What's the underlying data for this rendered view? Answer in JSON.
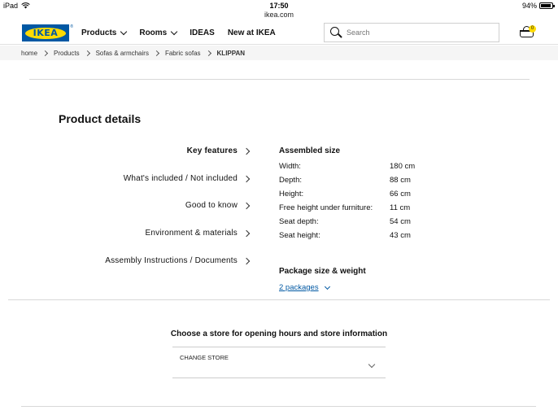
{
  "status_bar": {
    "device": "iPad",
    "time": "17:50",
    "battery": "94%",
    "battery_level": 0.94
  },
  "url": "ikea.com",
  "header": {
    "logo_text": "IKEA",
    "nav": [
      {
        "label": "Products",
        "dropdown": true
      },
      {
        "label": "Rooms",
        "dropdown": true
      },
      {
        "label": "IDEAS",
        "dropdown": false
      },
      {
        "label": "New at IKEA",
        "dropdown": false
      }
    ],
    "search_placeholder": "Search",
    "cart_count": "0"
  },
  "breadcrumb": [
    "home",
    "Products",
    "Sofas & armchairs",
    "Fabric sofas",
    "KLIPPAN"
  ],
  "product_details": {
    "title": "Product details",
    "features": [
      {
        "label": "Key features",
        "active": true
      },
      {
        "label": "What's included / Not included",
        "active": false
      },
      {
        "label": "Good to know",
        "active": false
      },
      {
        "label": "Environment & materials",
        "active": false
      },
      {
        "label": "Assembly Instructions / Documents",
        "active": false
      }
    ],
    "assembled_size": {
      "heading": "Assembled size",
      "dimensions": [
        {
          "label": "Width:",
          "value": "180 cm"
        },
        {
          "label": "Depth:",
          "value": "88 cm"
        },
        {
          "label": "Height:",
          "value": "66 cm"
        },
        {
          "label": "Free height under furniture:",
          "value": "11 cm"
        },
        {
          "label": "Seat depth:",
          "value": "54 cm"
        },
        {
          "label": "Seat height:",
          "value": "43 cm"
        }
      ]
    },
    "package": {
      "heading": "Package size & weight",
      "link": "2 packages"
    }
  },
  "store": {
    "title": "Choose a store for opening hours and store information",
    "select_label": "CHANGE STORE"
  }
}
